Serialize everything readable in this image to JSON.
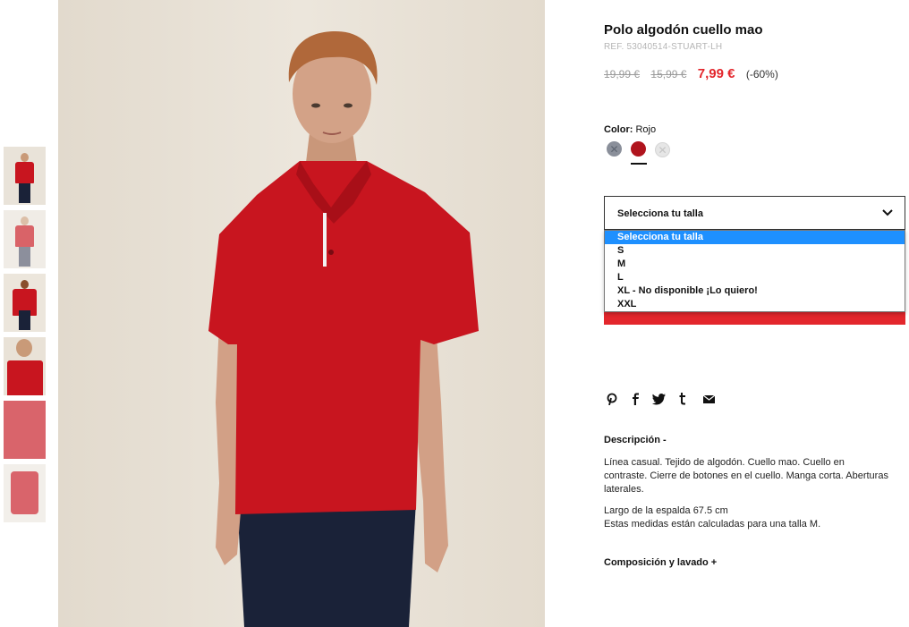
{
  "product": {
    "title": "Polo algodón cuello mao",
    "ref": "REF. 53040514-STUART-LH",
    "prices": {
      "original": "19,99 €",
      "previous": "15,99 €",
      "current": "7,99 €",
      "discount": "(-60%)"
    }
  },
  "color": {
    "label": "Color:",
    "value": "Rojo",
    "swatches": [
      {
        "name": "grey",
        "hex": "#8a8f9a",
        "available": false
      },
      {
        "name": "red",
        "hex": "#b0141d",
        "available": true,
        "selected": true
      },
      {
        "name": "white",
        "hex": "#e6e6e6",
        "available": false
      }
    ]
  },
  "size_select": {
    "placeholder": "Selecciona tu talla",
    "options": [
      "Selecciona tu talla",
      "S",
      "M",
      "L",
      "XL - No disponible ¡Lo quiero!",
      "XXL"
    ],
    "highlighted_index": 0
  },
  "social": [
    "pinterest-icon",
    "facebook-icon",
    "twitter-icon",
    "tumblr-icon",
    "email-icon"
  ],
  "description": {
    "title": "Descripción -",
    "text": "Línea casual. Tejido de algodón. Cuello mao. Cuello en contraste. Cierre de botones en el cuello. Manga corta. Aberturas laterales.",
    "measure_1": "Largo de la espalda 67.5 cm",
    "measure_2": "Estas medidas están calculadas para una talla M."
  },
  "composition": {
    "title": "Composición y lavado +"
  },
  "colors": {
    "accent": "#e3262c",
    "highlight": "#1e90ff"
  }
}
